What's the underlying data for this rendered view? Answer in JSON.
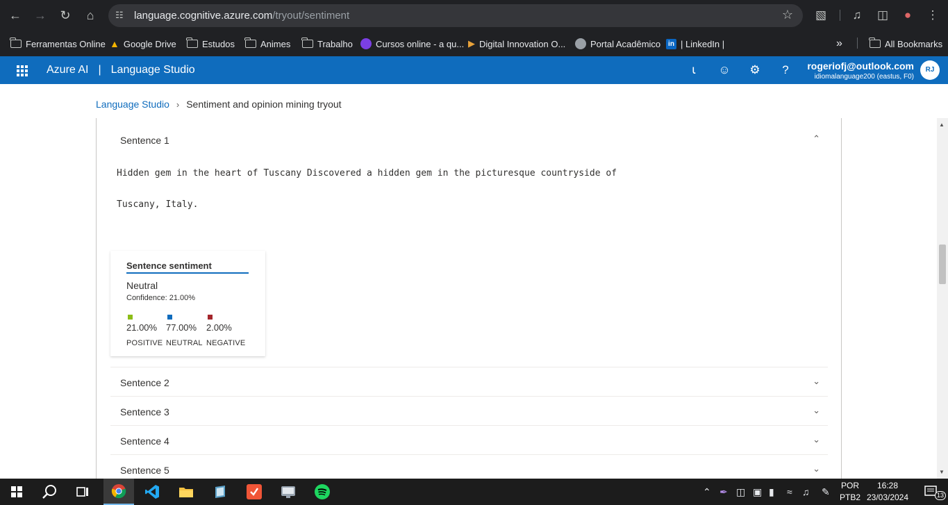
{
  "browser": {
    "url_host": "language.cognitive.azure.com",
    "url_path": "/tryout/sentiment",
    "bookmarks": [
      {
        "label": "Ferramentas Online"
      },
      {
        "label": "Google Drive"
      },
      {
        "label": "Estudos"
      },
      {
        "label": "Animes"
      },
      {
        "label": "Trabalho"
      },
      {
        "label": "Cursos online - a qu..."
      },
      {
        "label": "Digital Innovation O..."
      },
      {
        "label": "Portal Acadêmico"
      },
      {
        "label": "| LinkedIn |"
      }
    ],
    "all_bookmarks": "All Bookmarks"
  },
  "header": {
    "product": "Azure AI",
    "separator": "|",
    "studio": "Language Studio",
    "email": "rogeriofj@outlook.com",
    "resource": "idiomalanguage200 (eastus, F0)",
    "avatar_initials": "RJ"
  },
  "breadcrumb": {
    "root": "Language Studio",
    "current": "Sentiment and opinion mining tryout"
  },
  "sentences": [
    {
      "title": "Sentence 1"
    },
    {
      "title": "Sentence 2"
    },
    {
      "title": "Sentence 3"
    },
    {
      "title": "Sentence 4"
    },
    {
      "title": "Sentence 5"
    }
  ],
  "sentence1": {
    "line1": "Hidden gem in the heart of Tuscany Discovered a hidden gem in the picturesque countryside of",
    "line2": "Tuscany, Italy.",
    "card": {
      "title": "Sentence sentiment",
      "label": "Neutral",
      "confidence": "Confidence: 21.00%",
      "metrics": [
        {
          "value": "21.00%",
          "label": "POSITIVE",
          "color": "#8cbd18"
        },
        {
          "value": "77.00%",
          "label": "NEUTRAL",
          "color": "#0f6cbd"
        },
        {
          "value": "2.00%",
          "label": "NEGATIVE",
          "color": "#a4262c"
        }
      ]
    }
  },
  "taskbar": {
    "lang1": "POR",
    "lang2": "PTB2",
    "time": "16:28",
    "date": "23/03/2024",
    "notif_count": "13"
  },
  "colors": {
    "accent": "#0f6cbd",
    "browser_dark": "#202124"
  }
}
